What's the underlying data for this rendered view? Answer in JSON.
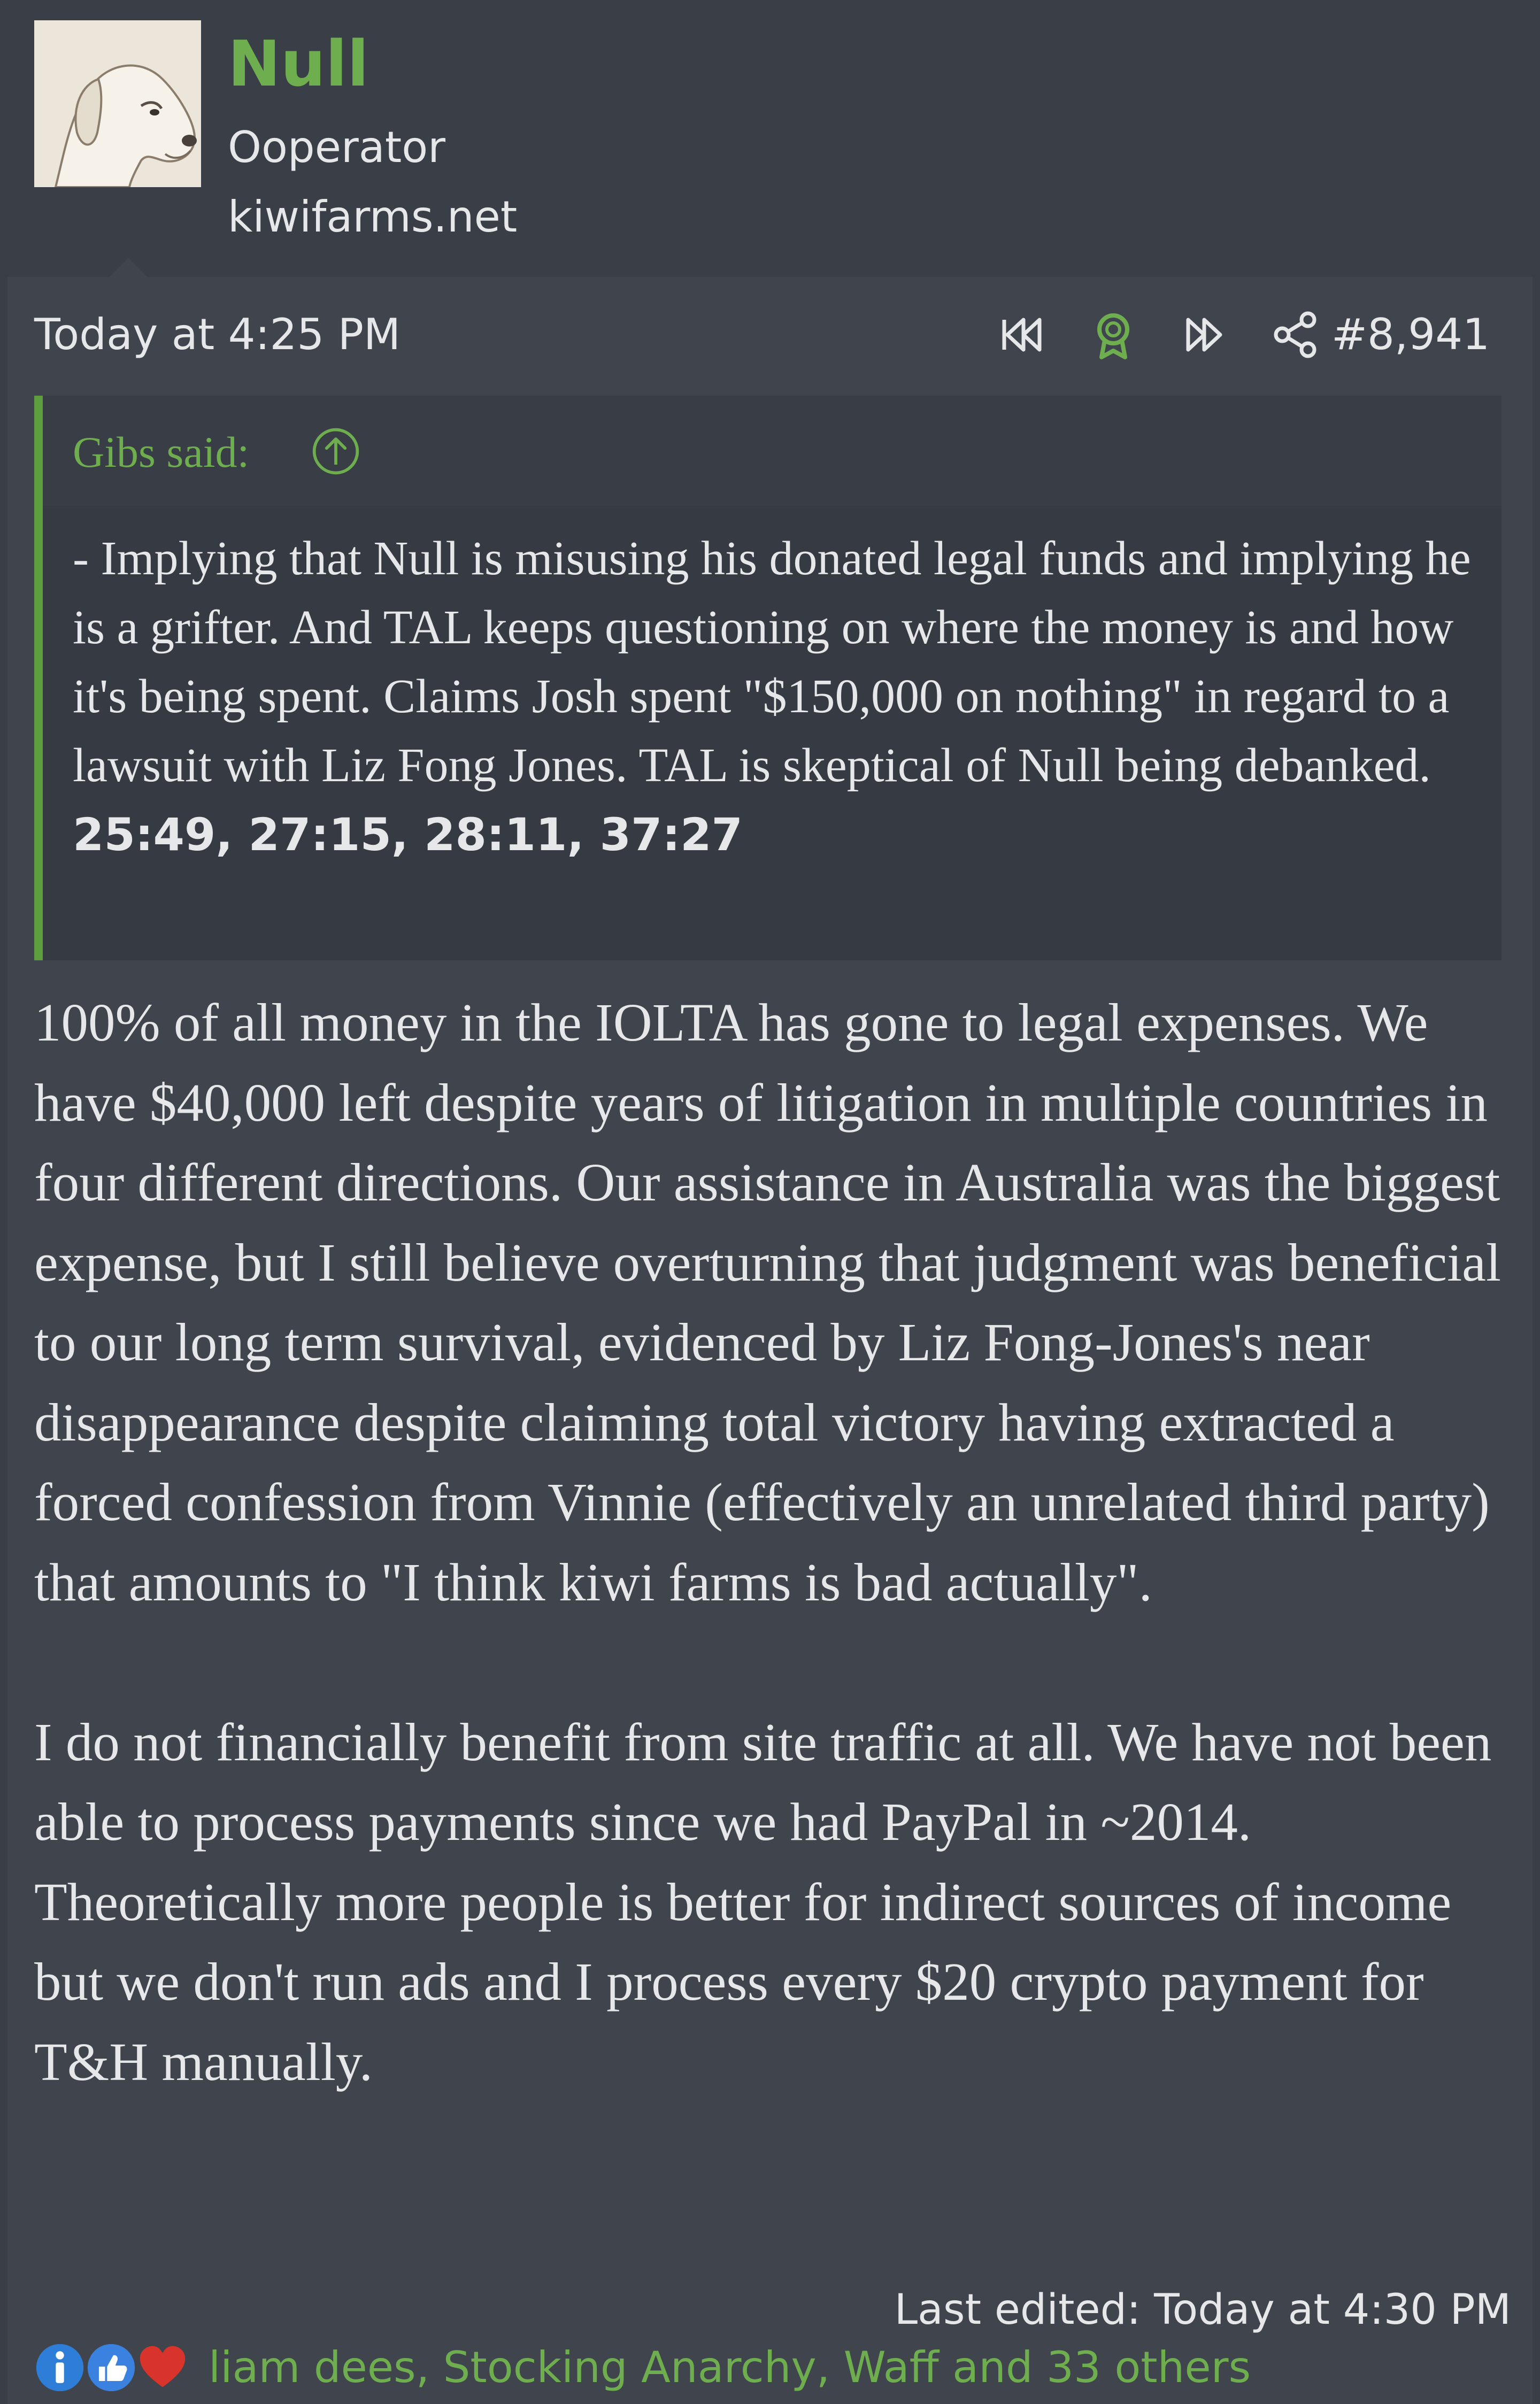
{
  "user": {
    "name": "Null",
    "title": "Ooperator",
    "site": "kiwifarms.net",
    "avatar_icon": "dog-avatar"
  },
  "post": {
    "date": "Today at 4:25 PM",
    "number": "#8,941",
    "icons": [
      "rewind-icon",
      "award-icon",
      "fast-forward-icon",
      "share-icon"
    ]
  },
  "quote": {
    "author": "Gibs said:",
    "text": "- Implying that Null is misusing his donated legal funds and implying he is a grifter. And TAL keeps questioning on where the money is and how it's being spent. Claims Josh spent \"$150,000 on nothing\" in regard to a lawsuit with Liz Fong Jones. TAL is skeptical of Null being debanked. ",
    "timestamps": "25:49, 27:15, 28:11, 37:27"
  },
  "body": {
    "paragraph1": "100% of all money in the IOLTA has gone to legal expenses. We have $40,000 left despite years of litigation in multiple countries in four different directions. Our assistance in Australia was the biggest expense, but I still believe overturning that judgment was beneficial to our long term survival, evidenced by Liz Fong-Jones's near disappearance despite claiming total victory having extracted a forced confession from Vinnie (effectively an unrelated third party) that amounts to \"I think kiwi farms is bad actually\".",
    "paragraph2": "I do not financially benefit from site traffic at all. We have not been able to process payments since we had PayPal in ~2014. Theoretically more people is better for indirect sources of income but we don't run ads and I process every $20 crypto payment for T&H manually."
  },
  "footer": {
    "last_edited": "Last edited: Today at 4:30 PM",
    "reactions_text": "liam dees, Stocking Anarchy, Waff and 33 others"
  },
  "colors": {
    "accent_green": "#6fae4e",
    "background": "#3f444d",
    "quote_bar": "#5f9e3f",
    "info_blue": "#2e7ed8",
    "like_blue": "#3b82e0",
    "heart_red": "#d8342c"
  }
}
